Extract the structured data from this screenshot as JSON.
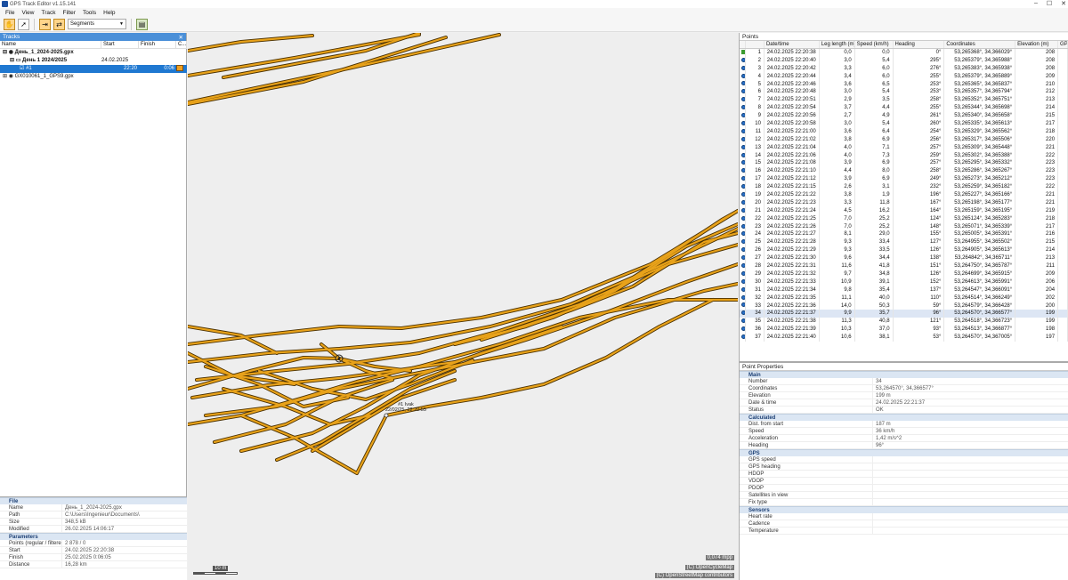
{
  "window": {
    "title": "GPS Track Editor v1.15.141"
  },
  "menu": [
    "File",
    "View",
    "Track",
    "Filter",
    "Tools",
    "Help"
  ],
  "toolbar": {
    "mode_select": "Segments"
  },
  "tracks_panel": {
    "title": "Tracks",
    "columns": [
      "Name",
      "Start",
      "Finish",
      "C..."
    ],
    "rows": [
      {
        "name": "День_1_2024-2025.gpx",
        "start": "",
        "finish": "",
        "bold": true
      },
      {
        "name": "День 1 2024/2025",
        "start": "24.02.2025",
        "finish": "",
        "bold": true
      },
      {
        "name": "#1",
        "start": "22:20",
        "finish": "0:06",
        "selected": true
      },
      {
        "name": "GX010061_1_GPS9.gpx",
        "start": "",
        "finish": ""
      }
    ]
  },
  "file_props": {
    "section_file": "File",
    "name_k": "Name",
    "name_v": "День_1_2024-2025.gpx",
    "path_k": "Path",
    "path_v": "C:\\Users\\Ingenieur\\Documents\\",
    "size_k": "Size",
    "size_v": "348,5 kB",
    "mod_k": "Modified",
    "mod_v": "26.02.2025 14:06:17",
    "section_params": "Parameters",
    "points_k": "Points (regular / filtered)",
    "points_v": "2 878 / 0",
    "start_k": "Start",
    "start_v": "24.02.2025 22:20:38",
    "finish_k": "Finish",
    "finish_v": "25.02.2025 0:06:05",
    "dist_k": "Distance",
    "dist_v": "16,28 km"
  },
  "map": {
    "scale": "10 m",
    "zoom": "0,074 mpp",
    "attribution1": "(C) OpenCycleMap",
    "attribution2": "(C) OpenStreetMap contributors",
    "label_line1": "#1 Ivak",
    "label_line2": "22/02/25, 22:20:55"
  },
  "points_panel": {
    "title": "Points",
    "columns": [
      "",
      "",
      "Date/time",
      "Leg length (m)",
      "Speed (km/h)",
      "Heading",
      "Coordinates",
      "Elevation (m)",
      "GP"
    ],
    "rows": [
      [
        "1",
        "24.02.2025 22:20:38",
        "0,0",
        "0,0",
        "0°",
        "53,265368°, 34,366029°",
        "208"
      ],
      [
        "2",
        "24.02.2025 22:20:40",
        "3,0",
        "5,4",
        "295°",
        "53,265379°, 34,365988°",
        "208"
      ],
      [
        "3",
        "24.02.2025 22:20:42",
        "3,3",
        "6,0",
        "276°",
        "53,265383°, 34,365938°",
        "208"
      ],
      [
        "4",
        "24.02.2025 22:20:44",
        "3,4",
        "6,0",
        "255°",
        "53,265379°, 34,365889°",
        "209"
      ],
      [
        "5",
        "24.02.2025 22:20:46",
        "3,6",
        "6,5",
        "253°",
        "53,265365°, 34,365837°",
        "210"
      ],
      [
        "6",
        "24.02.2025 22:20:48",
        "3,0",
        "5,4",
        "253°",
        "53,265357°, 34,365794°",
        "212"
      ],
      [
        "7",
        "24.02.2025 22:20:51",
        "2,9",
        "3,5",
        "258°",
        "53,265352°, 34,365751°",
        "213"
      ],
      [
        "8",
        "24.02.2025 22:20:54",
        "3,7",
        "4,4",
        "255°",
        "53,265344°, 34,365698°",
        "214"
      ],
      [
        "9",
        "24.02.2025 22:20:56",
        "2,7",
        "4,9",
        "261°",
        "53,265340°, 34,365658°",
        "215"
      ],
      [
        "10",
        "24.02.2025 22:20:58",
        "3,0",
        "5,4",
        "260°",
        "53,265335°, 34,365613°",
        "217"
      ],
      [
        "11",
        "24.02.2025 22:21:00",
        "3,6",
        "6,4",
        "254°",
        "53,265329°, 34,365562°",
        "218"
      ],
      [
        "12",
        "24.02.2025 22:21:02",
        "3,8",
        "6,9",
        "256°",
        "53,265317°, 34,365506°",
        "220"
      ],
      [
        "13",
        "24.02.2025 22:21:04",
        "4,0",
        "7,1",
        "257°",
        "53,265309°, 34,365448°",
        "221"
      ],
      [
        "14",
        "24.02.2025 22:21:06",
        "4,0",
        "7,3",
        "259°",
        "53,265302°, 34,365388°",
        "222"
      ],
      [
        "15",
        "24.02.2025 22:21:08",
        "3,9",
        "6,9",
        "257°",
        "53,265295°, 34,365332°",
        "223"
      ],
      [
        "16",
        "24.02.2025 22:21:10",
        "4,4",
        "8,0",
        "258°",
        "53,265286°, 34,365267°",
        "223"
      ],
      [
        "17",
        "24.02.2025 22:21:12",
        "3,9",
        "6,9",
        "249°",
        "53,265273°, 34,365212°",
        "223"
      ],
      [
        "18",
        "24.02.2025 22:21:15",
        "2,6",
        "3,1",
        "232°",
        "53,265259°, 34,365182°",
        "222"
      ],
      [
        "19",
        "24.02.2025 22:21:22",
        "3,8",
        "1,9",
        "196°",
        "53,265227°, 34,365166°",
        "221"
      ],
      [
        "20",
        "24.02.2025 22:21:23",
        "3,3",
        "11,8",
        "167°",
        "53,265198°, 34,365177°",
        "221"
      ],
      [
        "21",
        "24.02.2025 22:21:24",
        "4,5",
        "16,2",
        "164°",
        "53,265159°, 34,365195°",
        "219"
      ],
      [
        "22",
        "24.02.2025 22:21:25",
        "7,0",
        "25,2",
        "124°",
        "53,265124°, 34,365283°",
        "218"
      ],
      [
        "23",
        "24.02.2025 22:21:26",
        "7,0",
        "25,2",
        "148°",
        "53,265071°, 34,365339°",
        "217"
      ],
      [
        "24",
        "24.02.2025 22:21:27",
        "8,1",
        "29,0",
        "155°",
        "53,265005°, 34,365391°",
        "216"
      ],
      [
        "25",
        "24.02.2025 22:21:28",
        "9,3",
        "33,4",
        "127°",
        "53,264955°, 34,365502°",
        "215"
      ],
      [
        "26",
        "24.02.2025 22:21:29",
        "9,3",
        "33,5",
        "126°",
        "53,264905°, 34,365613°",
        "214"
      ],
      [
        "27",
        "24.02.2025 22:21:30",
        "9,6",
        "34,4",
        "138°",
        "53,264842°, 34,365711°",
        "213"
      ],
      [
        "28",
        "24.02.2025 22:21:31",
        "11,6",
        "41,8",
        "151°",
        "53,264750°, 34,365787°",
        "211"
      ],
      [
        "29",
        "24.02.2025 22:21:32",
        "9,7",
        "34,8",
        "126°",
        "53,264699°, 34,365915°",
        "209"
      ],
      [
        "30",
        "24.02.2025 22:21:33",
        "10,9",
        "39,1",
        "152°",
        "53,264613°, 34,365991°",
        "206"
      ],
      [
        "31",
        "24.02.2025 22:21:34",
        "9,8",
        "35,4",
        "137°",
        "53,264547°, 34,366091°",
        "204"
      ],
      [
        "32",
        "24.02.2025 22:21:35",
        "11,1",
        "40,0",
        "110°",
        "53,264514°, 34,366249°",
        "202"
      ],
      [
        "33",
        "24.02.2025 22:21:36",
        "14,0",
        "50,3",
        "59°",
        "53,264579°, 34,366428°",
        "200"
      ],
      [
        "34",
        "24.02.2025 22:21:37",
        "9,9",
        "35,7",
        "96°",
        "53,264570°, 34,366577°",
        "199"
      ],
      [
        "35",
        "24.02.2025 22:21:38",
        "11,3",
        "40,8",
        "121°",
        "53,264518°, 34,366723°",
        "199"
      ],
      [
        "36",
        "24.02.2025 22:21:39",
        "10,3",
        "37,0",
        "93°",
        "53,264513°, 34,366877°",
        "198"
      ],
      [
        "37",
        "24.02.2025 22:21:40",
        "10,6",
        "38,1",
        "53°",
        "53,264570°, 34,367005°",
        "197"
      ]
    ],
    "highlight_row": "34"
  },
  "point_props": {
    "title": "Point Properties",
    "sec_main": "Main",
    "number_k": "Number",
    "number_v": "34",
    "coord_k": "Coordinates",
    "coord_v": "53,264570°, 34,366577°",
    "elev_k": "Elevation",
    "elev_v": "199 m",
    "date_k": "Date & time",
    "date_v": "24.02.2025 22:21:37",
    "status_k": "Status",
    "status_v": "OK",
    "sec_calc": "Calculated",
    "dist_k": "Dist. from start",
    "dist_v": "187 m",
    "speed_k": "Speed",
    "speed_v": "36 km/h",
    "accel_k": "Acceleration",
    "accel_v": "1,42 m/s^2",
    "heading_k": "Heading",
    "heading_v": "96°",
    "sec_gps": "GPS",
    "gpsspeed_k": "GPS speed",
    "gpsheading_k": "GPS heading",
    "hdop_k": "HDOP",
    "vdop_k": "VDOP",
    "pdop_k": "PDOP",
    "sats_k": "Satellites in view",
    "fix_k": "Fix type",
    "sec_sensors": "Sensors",
    "hr_k": "Heart rate",
    "cad_k": "Cadence",
    "temp_k": "Temperature"
  },
  "colors": {
    "track": "#e8a21a",
    "track_outline": "#4a3000",
    "selection": "#1f78d1",
    "section_bg": "#dbe6f3"
  }
}
